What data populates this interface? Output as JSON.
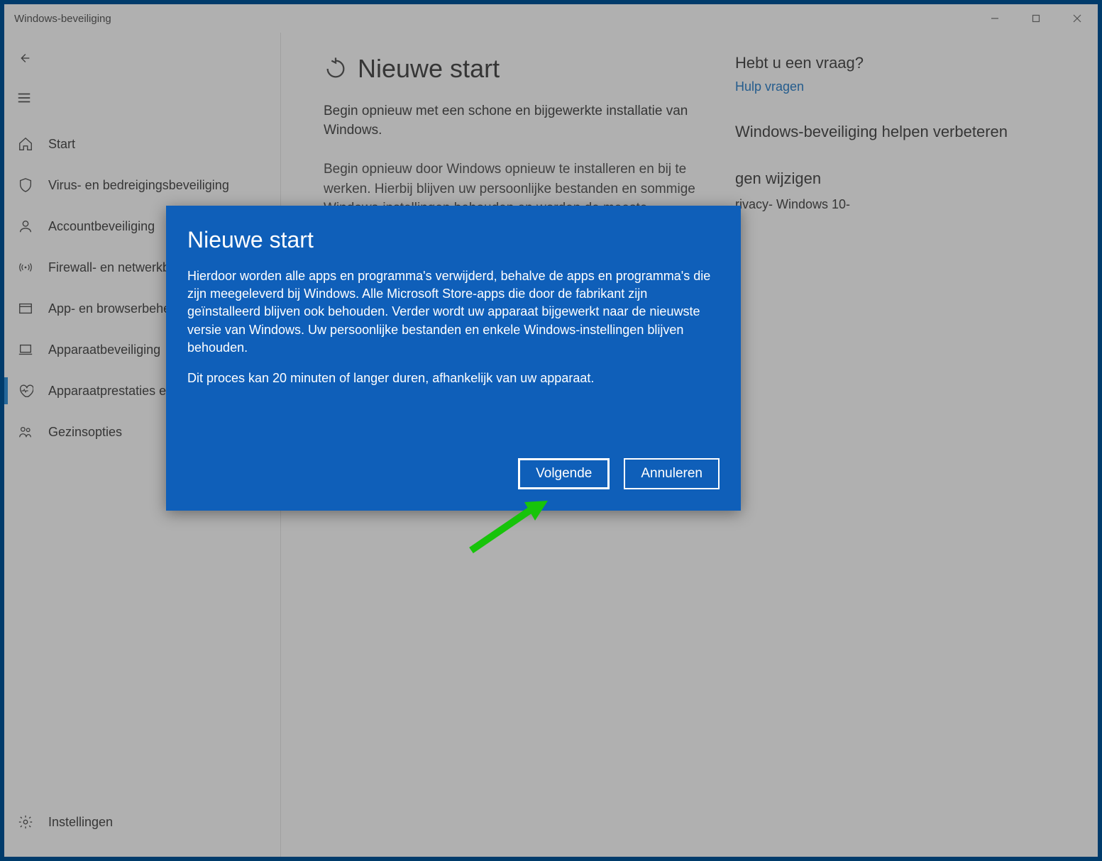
{
  "title": "Windows-beveiliging",
  "sidebar": {
    "items": [
      {
        "label": "Start"
      },
      {
        "label": "Virus- en bedreigingsbeveiliging"
      },
      {
        "label": "Accountbeveiliging"
      },
      {
        "label": "Firewall- en netwerkbe"
      },
      {
        "label": "App- en browserbehee"
      },
      {
        "label": "Apparaatbeveiliging"
      },
      {
        "label": "Apparaatprestaties en"
      },
      {
        "label": "Gezinsopties"
      }
    ],
    "settings_label": "Instellingen"
  },
  "page": {
    "heading": "Nieuwe start",
    "intro": "Begin opnieuw met een schone en bijgewerkte installatie van Windows.",
    "desc": "Begin opnieuw door Windows opnieuw te installeren en bij te werken. Hierbij blijven uw persoonlijke bestanden en sommige Windows-instellingen behouden en worden de meeste"
  },
  "aside": {
    "q_heading": "Hebt u een vraag?",
    "help_link": "Hulp vragen",
    "improve_heading": "Windows-beveiliging helpen verbeteren",
    "privacy_heading": "gen wijzigen",
    "privacy_text": "rivacy-\n Windows 10-"
  },
  "dialog": {
    "title": "Nieuwe start",
    "p1": "Hierdoor worden alle apps en programma's verwijderd, behalve de apps en programma's die zijn meegeleverd bij Windows. Alle Microsoft Store-apps die door de fabrikant zijn geïnstalleerd blijven ook behouden. Verder wordt uw apparaat bijgewerkt naar de nieuwste versie van Windows. Uw persoonlijke bestanden en enkele Windows-instellingen blijven behouden.",
    "p2": "Dit proces kan 20 minuten of langer duren, afhankelijk van uw apparaat.",
    "next": "Volgende",
    "cancel": "Annuleren"
  }
}
